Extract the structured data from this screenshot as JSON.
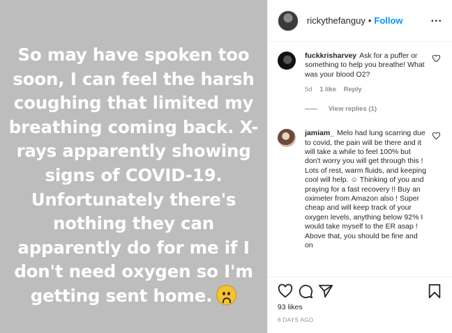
{
  "post": {
    "image_text": "So may have spoken too soon, I can feel the harsh coughing that limited my breathing coming back. X-rays apparently showing signs of COVID-19. Unfortunately there's nothing they can apparently do for me if I don't need oxygen so I'm getting sent home.",
    "image_emoji": "frowning-face-emoji",
    "background_color": "#bdbdbd"
  },
  "header": {
    "username": "rickythefanguy",
    "separator": "•",
    "follow_label": "Follow",
    "more_label": "..."
  },
  "comments": [
    {
      "username": "fuckkrisharvey",
      "text": "Ask for a puffer or something to help you breathe! What was your blood O2?",
      "age": "5d",
      "likes": "1 like",
      "reply_label": "Reply",
      "view_replies": "View replies (1)"
    },
    {
      "username": "jamiam_",
      "text": "Melo had lung scarring due to covid, the pain will be there and it will take a while to feel 100% but don't worry you will get through this ! Lots of rest, warm fluids, and keeping cool will help. ☺ Thinking of you and praying for a fast recovery !! Buy an oximeter from Amazon also ! Super cheap and will keep track of your oxygen levels, anything below 92% I would take myself to the ER asap ! Above that, you should be fine and on"
    }
  ],
  "footer": {
    "likes": "93 likes",
    "timestamp": "6 DAYS AGO",
    "icons": [
      "heart-icon",
      "comment-icon",
      "share-icon",
      "bookmark-icon"
    ]
  },
  "colors": {
    "accent": "#0095f6",
    "muted": "#8e8e8e",
    "text": "#262626"
  }
}
